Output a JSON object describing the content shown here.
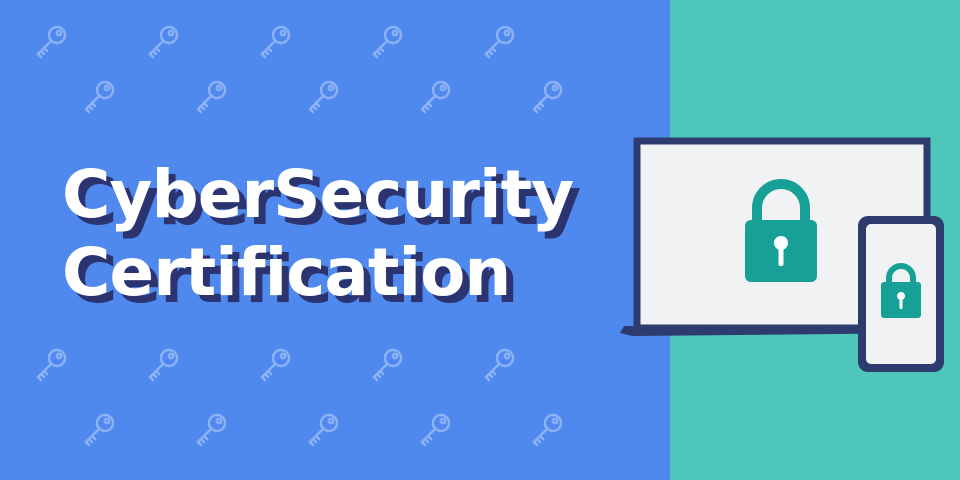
{
  "title": {
    "line1": "CyberSecurity",
    "line2": "Certification"
  },
  "colors": {
    "left_bg": "#4F89EE",
    "right_bg": "#4EC6BA",
    "title_text": "#FFFFFF",
    "title_shadow": "#2B3470",
    "key_pattern": "#8DB1F5",
    "device_frame": "#2E3B6E",
    "screen_bg": "#F1F2F4",
    "lock_color": "#17A096"
  },
  "icons": {
    "pattern": "key-icon",
    "laptop_lock": "padlock-icon",
    "phone_lock": "padlock-icon"
  }
}
